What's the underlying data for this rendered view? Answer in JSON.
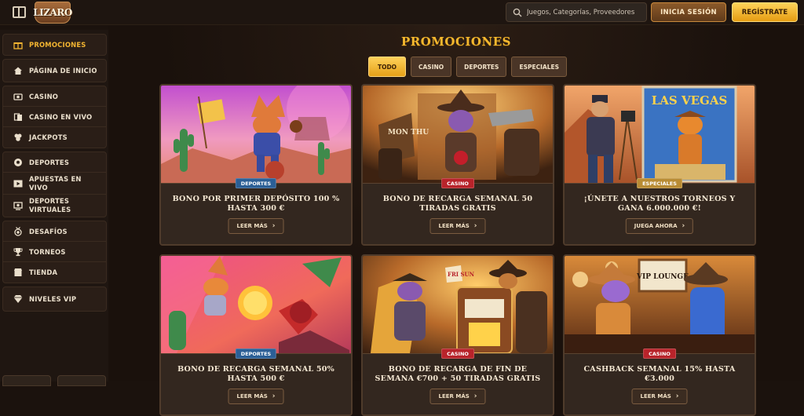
{
  "header": {
    "logo_text": "LIZARO",
    "search_placeholder": "Juegos, Categorías, Proveedores",
    "login_label": "INICIA SESIÓN",
    "register_label": "REGÍSTRATE"
  },
  "sidebar": {
    "items": [
      {
        "label": "PROMOCIONES",
        "icon": "gift-icon",
        "active": true
      },
      {
        "label": "PÁGINA DE INICIO",
        "icon": "home-icon"
      },
      {
        "label": "CASINO",
        "icon": "casino-chip-icon"
      },
      {
        "label": "CASINO EN VIVO",
        "icon": "cards-icon"
      },
      {
        "label": "JACKPOTS",
        "icon": "jackpot-icon"
      },
      {
        "label": "DEPORTES",
        "icon": "soccer-ball-icon"
      },
      {
        "label": "APUESTAS EN VIVO",
        "icon": "live-play-icon"
      },
      {
        "label": "DEPORTES VIRTUALES",
        "icon": "virtual-sports-icon"
      },
      {
        "label": "DESAFÍOS",
        "icon": "medal-icon"
      },
      {
        "label": "TORNEOS",
        "icon": "trophy-icon"
      },
      {
        "label": "TIENDA",
        "icon": "shop-icon"
      },
      {
        "label": "NIVELES VIP",
        "icon": "diamond-icon"
      }
    ]
  },
  "main": {
    "title": "PROMOCIONES",
    "filters": [
      "TODO",
      "CASINO",
      "DEPORTES",
      "ESPECIALES"
    ],
    "active_filter": "TODO",
    "cards": [
      {
        "badge": "DEPORTES",
        "badge_type": "dep",
        "title": "BONO POR PRIMER DEPÓSITO 100 % HASTA 300 €",
        "button": "LEER MÁS",
        "art": "cowboy-lizard-desert"
      },
      {
        "badge": "CASINO",
        "badge_type": "cas",
        "title": "BONO DE RECARGA SEMANAL 50 TIRADAS GRATIS",
        "button": "LEER MÁS",
        "art": "saloon-showdown",
        "sign_text": "MON THU"
      },
      {
        "badge": "ESPECIALES",
        "badge_type": "esp",
        "title": "¡ÚNETE A NUESTROS TORNEOS Y GANA 6.000.000 €!",
        "button": "JUEGA AHORA",
        "art": "las-vegas-billboard",
        "sign_text": "LAS VEGAS"
      },
      {
        "badge": "DEPORTES",
        "badge_type": "dep",
        "title": "BONO DE RECARGA SEMANAL 50% HASTA 500 €",
        "button": "LEER MÁS",
        "art": "flying-lizard"
      },
      {
        "badge": "CASINO",
        "badge_type": "cas",
        "title": "BONO DE RECARGA DE FIN DE SEMANA €700 + 50 TIRADAS GRATIS",
        "button": "LEER MÁS",
        "art": "slot-machine",
        "sign_text": "FRI SUN"
      },
      {
        "badge": "CASINO",
        "badge_type": "cas",
        "title": "CASHBACK SEMANAL 15% HASTA €3.000",
        "button": "LEER MÁS",
        "art": "vip-lounge",
        "sign_text": "VIP LOUNGE"
      }
    ]
  },
  "colors": {
    "accent": "#f5b82e",
    "background": "#1b120d",
    "badge_deportes": "#2b5f96",
    "badge_casino": "#b8232a",
    "badge_especiales": "#b98c34"
  }
}
